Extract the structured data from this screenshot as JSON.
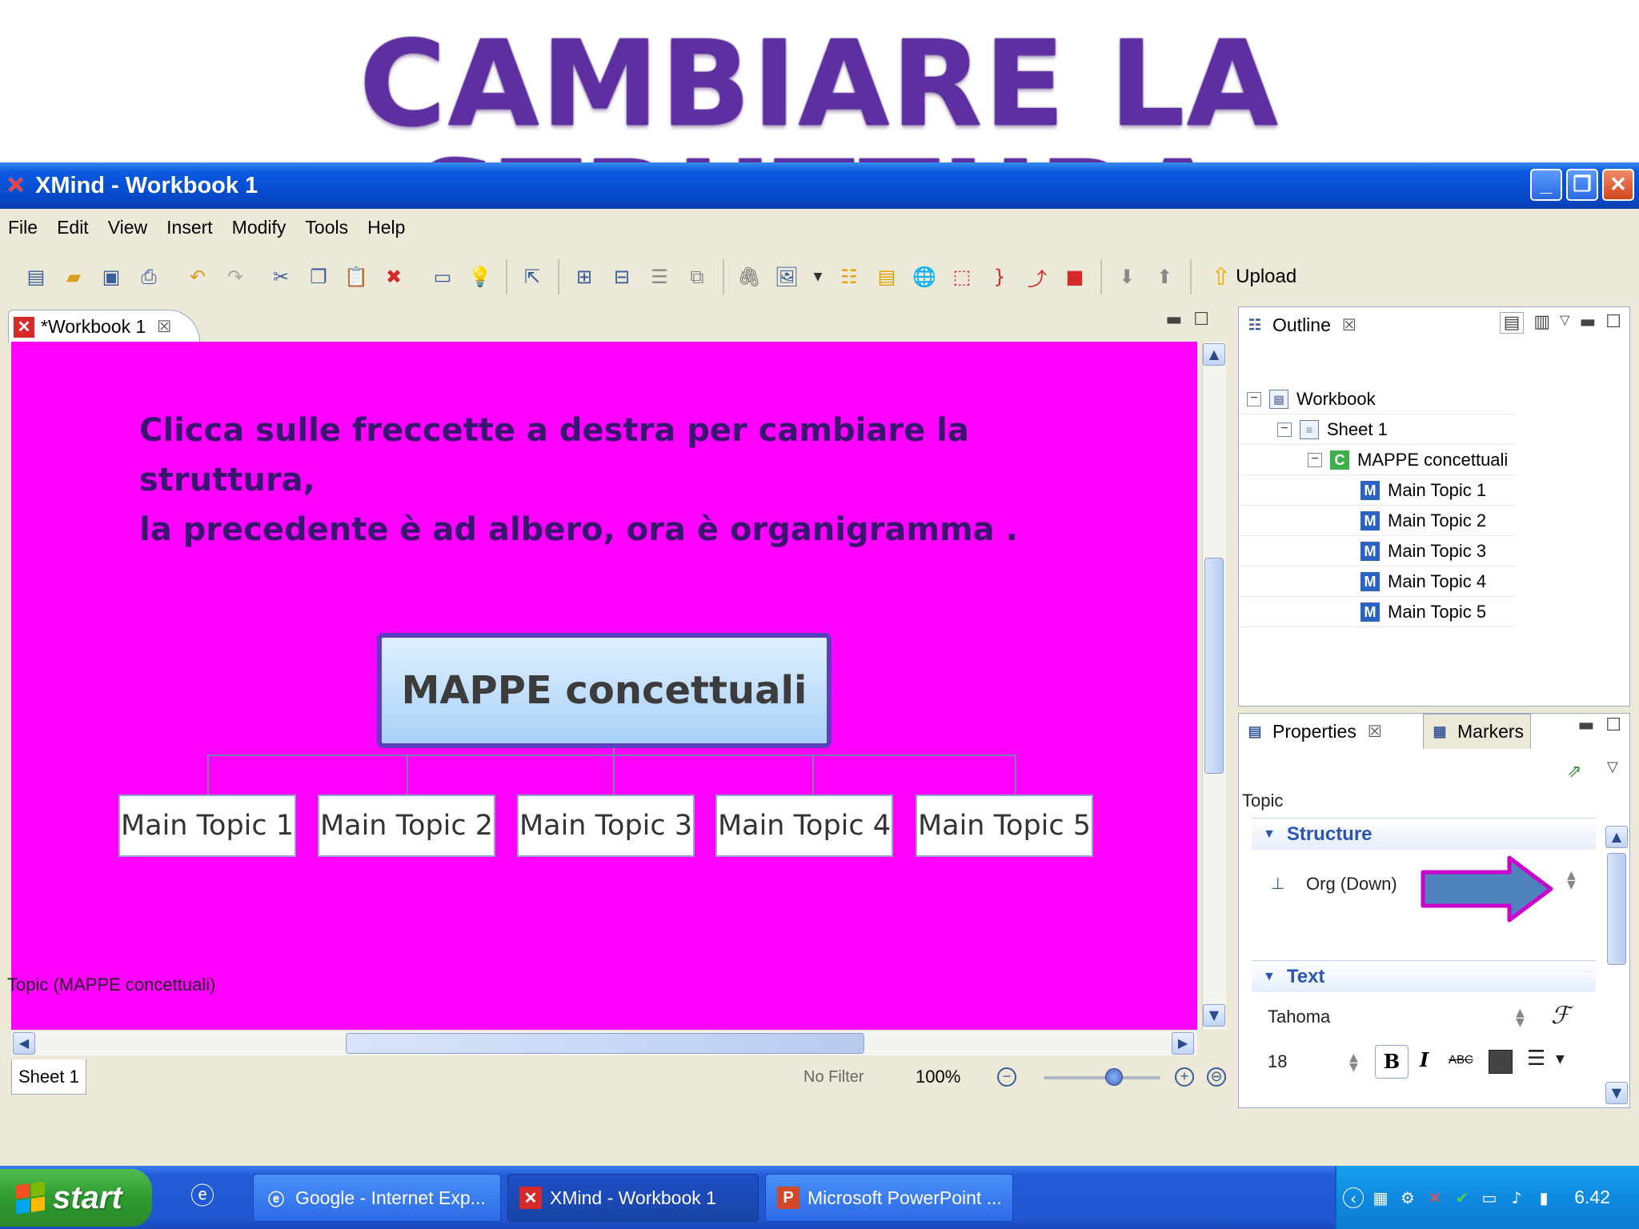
{
  "slide_title": "CAMBIARE LA STRUTTURA",
  "window": {
    "title": "XMind - Workbook 1",
    "controls": {
      "minimize": "_",
      "maximize": "❐",
      "close": "✕"
    }
  },
  "menu": [
    "File",
    "Edit",
    "View",
    "Insert",
    "Modify",
    "Tools",
    "Help"
  ],
  "toolbar": {
    "upload_label": "Upload"
  },
  "editor": {
    "tab_label": "*Workbook 1",
    "hint_line1": "Clicca sulle freccette a destra per cambiare la struttura,",
    "hint_line2": "la precedente è ad albero, ora è organigramma .",
    "central_topic": "MAPPE concettuali",
    "topics": [
      "Main Topic 1",
      "Main Topic 2",
      "Main Topic 3",
      "Main Topic 4",
      "Main Topic 5"
    ],
    "sheet_tab": "Sheet 1",
    "filter": "No Filter",
    "zoom": "100%",
    "zoom_level": 0.6
  },
  "outline": {
    "tab_label": "Outline",
    "workbook": "Workbook",
    "sheet": "Sheet 1",
    "central": "MAPPE concettuali",
    "topics": [
      "Main Topic 1",
      "Main Topic 2",
      "Main Topic 3",
      "Main Topic 4",
      "Main Topic 5"
    ]
  },
  "properties": {
    "tab_label": "Properties",
    "markers_tab_label": "Markers",
    "context": "Topic",
    "structure_section": "Structure",
    "structure_value": "Org (Down)",
    "text_section": "Text",
    "font_name": "Tahoma",
    "font_size": "18",
    "bold": "B",
    "italic": "I",
    "strike": "ABC"
  },
  "status_line": "Topic (MAPPE concettuali)",
  "taskbar": {
    "start_label": "start",
    "tasks": [
      "Google - Internet Exp...",
      "XMind - Workbook 1",
      "Microsoft PowerPoint ..."
    ],
    "clock": "6.42"
  },
  "colors": {
    "canvas_bg": "#ff00ff",
    "central_border": "#5b3fbf",
    "hint_text": "#3a1570",
    "arrow_fill": "#4f81bd",
    "arrow_stroke": "#cc00cc",
    "title_purple": "#5d2fa0"
  }
}
